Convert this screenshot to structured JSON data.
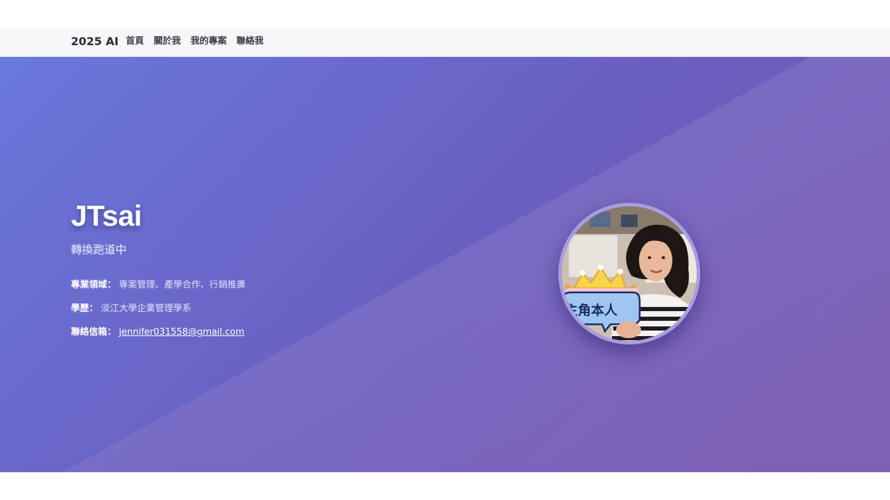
{
  "nav": {
    "brand": "2025 AI",
    "links": [
      "首頁",
      "關於我",
      "我的專案",
      "聯絡我"
    ]
  },
  "hero": {
    "name": "JTsai",
    "tagline": "轉換跑道中",
    "info": [
      {
        "label": "專業領域：",
        "value": "專案管理、產學合作、行銷推廣"
      },
      {
        "label": "學歷：",
        "value": "淡江大學企業管理學系"
      },
      {
        "label": "聯絡信箱：",
        "value": "jennifer031558@gmail.com"
      }
    ],
    "avatar_sign_text": "主角本人"
  },
  "colors": {
    "hero_gradient_start": "#6a78dc",
    "hero_gradient_mid": "#6a5fc0",
    "hero_gradient_end": "#7b5ab0",
    "navbar_bg": "#f7f7fa"
  }
}
